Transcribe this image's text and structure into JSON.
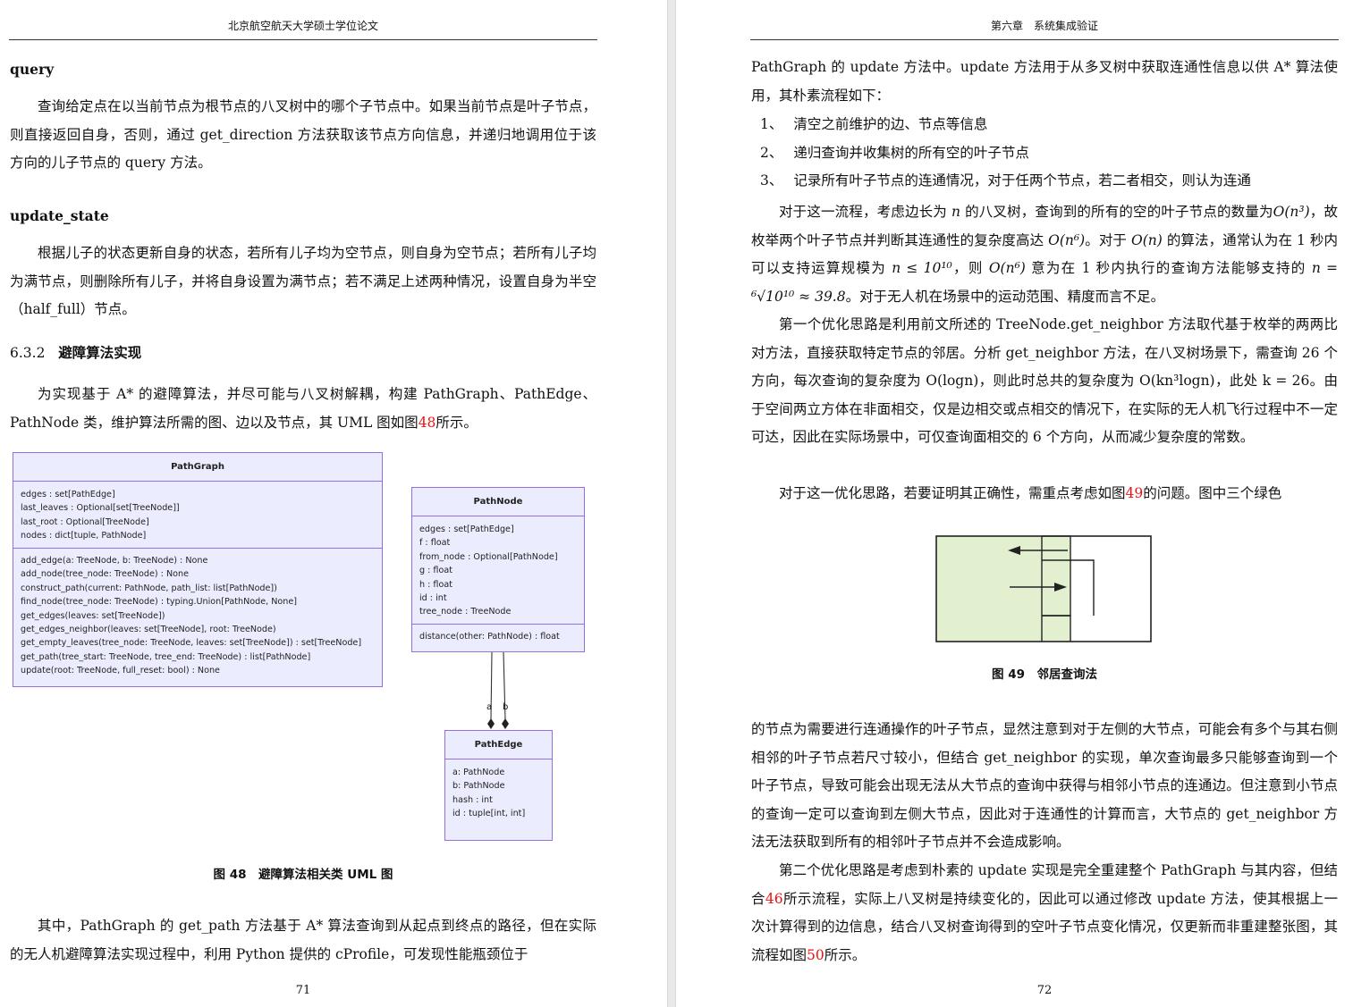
{
  "left_page": {
    "header": "北京航空航天大学硕士学位论文",
    "section_query": {
      "heading": "query",
      "text": "查询给定点在以当前节点为根节点的八叉树中的哪个子节点中。如果当前节点是叶子节点，则直接返回自身，否则，通过 get_direction 方法获取该节点方向信息，并递归地调用位于该方向的儿子节点的 query 方法。"
    },
    "section_update_state": {
      "heading": "update_state",
      "text": "根据儿子的状态更新自身的状态，若所有儿子均为空节点，则自身为空节点；若所有儿子均为满节点，则删除所有儿子，并将自身设置为满节点；若不满足上述两种情况，设置自身为半空（half_full）节点。"
    },
    "subsection": {
      "number": "6.3.2",
      "title": "避障算法实现"
    },
    "intro": {
      "before_ref": "为实现基于 A* 的避障算法，并尽可能与八叉树解耦，构建 PathGraph、PathEdge、PathNode 类，维护算法所需的图、边以及节点，其 UML 图如图",
      "ref": "48",
      "after_ref": "所示。"
    },
    "uml": {
      "pathgraph": {
        "name": "PathGraph",
        "attributes": [
          "edges : set[PathEdge]",
          "last_leaves : Optional[set[TreeNode]]",
          "last_root : Optional[TreeNode]",
          "nodes : dict[tuple, PathNode]"
        ],
        "methods": [
          "add_edge(a: TreeNode, b: TreeNode) : None",
          "add_node(tree_node: TreeNode) : None",
          "construct_path(current: PathNode, path_list: list[PathNode])",
          "find_node(tree_node: TreeNode) : typing.Union[PathNode, None]",
          "get_edges(leaves: set[TreeNode])",
          "get_edges_neighbor(leaves: set[TreeNode], root: TreeNode)",
          "get_empty_leaves(tree_node: TreeNode, leaves: set[TreeNode]) : set[TreeNode]",
          "get_path(tree_start: TreeNode, tree_end: TreeNode) : list[PathNode]",
          "update(root: TreeNode, full_reset: bool) : None"
        ]
      },
      "pathnode": {
        "name": "PathNode",
        "attributes": [
          "edges : set[PathEdge]",
          "f : float",
          "from_node : Optional[PathNode]",
          "g : float",
          "h : float",
          "id : int",
          "tree_node : TreeNode"
        ],
        "methods": [
          "distance(other: PathNode) : float"
        ]
      },
      "pathedge": {
        "name": "PathEdge",
        "attributes": [
          "a: PathNode",
          "b: PathNode",
          "hash : int",
          "id : tuple[int, int]"
        ]
      },
      "assoc_label_a": "a",
      "assoc_label_b": "b"
    },
    "figure48_caption": "图 48　避障算法相关类 UML 图",
    "bottom_text": "其中，PathGraph 的 get_path 方法基于 A* 算法查询到从起点到终点的路径，但在实际的无人机避障算法实现过程中，利用 Python 提供的 cProfile，可发现性能瓶颈位于",
    "page_number": "71"
  },
  "right_page": {
    "header": "第六章　系统集成验证",
    "para1": "PathGraph 的 update 方法中。update 方法用于从多叉树中获取连通性信息以供 A* 算法使用，其朴素流程如下：",
    "steps": [
      {
        "num": "1、",
        "text": "清空之前维护的边、节点等信息"
      },
      {
        "num": "2、",
        "text": "递归查询并收集树的所有空的叶子节点"
      },
      {
        "num": "3、",
        "text": "记录所有叶子节点的连通情况，对于任两个节点，若二者相交，则认为连通"
      }
    ],
    "para2": {
      "s1": "对于这一流程，考虑边长为",
      "n": "n",
      "s2": "的八叉树，查询到的所有的空的叶子节点的数量为",
      "o_n3": "O(n³)",
      "s3": "，故枚举两个叶子节点并判断其连通性的复杂度高达",
      "o_n6": "O(n⁶)",
      "s4": "。对于",
      "o_n": "O(n)",
      "s5": "的算法，通常认为在 1 秒内可以支持运算规模为",
      "cond": "n ≤ 10¹⁰",
      "s6": "，则",
      "o_n6b": "O(n⁶)",
      "s7": "意为在 1 秒内执行的查询方法能够支持的",
      "result": "n = ⁶√10¹⁰ ≈ 39.8",
      "s8": "。对于无人机在场景中的运动范围、精度而言不足。"
    },
    "para3": "第一个优化思路是利用前文所述的 TreeNode.get_neighbor 方法取代基于枚举的两两比对方法，直接获取特定节点的邻居。分析 get_neighbor 方法，在八叉树场景下，需查询 26 个方向，每次查询的复杂度为 O(logn)，则此时总共的复杂度为 O(kn³logn)，此处 k = 26。由于空间两立方体在非面相交，仅是边相交或点相交的情况下，在实际的无人机飞行过程中不一定可达，因此在实际场景中，可仅查询面相交的 6 个方向，从而减少复杂度的常数。",
    "para4": {
      "before_ref": "对于这一优化思路，若要证明其正确性，需重点考虑如图",
      "ref": "49",
      "after_ref": "的问题。图中三个绿色"
    },
    "figure49_caption": "图 49　邻居查询法",
    "para5": "的节点为需要进行连通操作的叶子节点，显然注意到对于左侧的大节点，可能会有多个与其右侧相邻的叶子节点若尺寸较小，但结合 get_neighbor 的实现，单次查询最多只能够查询到一个叶子节点，导致可能会出现无法从大节点的查询中获得与相邻小节点的连通边。但注意到小节点的查询一定可以查询到左侧大节点，因此对于连通性的计算而言，大节点的 get_neighbor 方法无法获取到所有的相邻叶子节点并不会造成影响。",
    "para6": {
      "before_ref": "第二个优化思路是考虑到朴素的 update 实现是完全重建整个 PathGraph 与其内容，但结合",
      "ref": "46",
      "after_ref": "所示流程，实际上八叉树是持续变化的，因此可以通过修改 update 方法，使其根据上一次计算得到的边信息，结合八叉树查询得到的空叶子节点变化情况，仅更新而非重建整张图，其流程如图"
    },
    "para6_ref2": "50",
    "para6_end": "所示。",
    "page_number": "72"
  },
  "colors": {
    "uml_fill": "#ECECFF",
    "uml_border": "#9370DB",
    "leaf_green": "#E2F0D0",
    "ref_red": "#e11"
  }
}
